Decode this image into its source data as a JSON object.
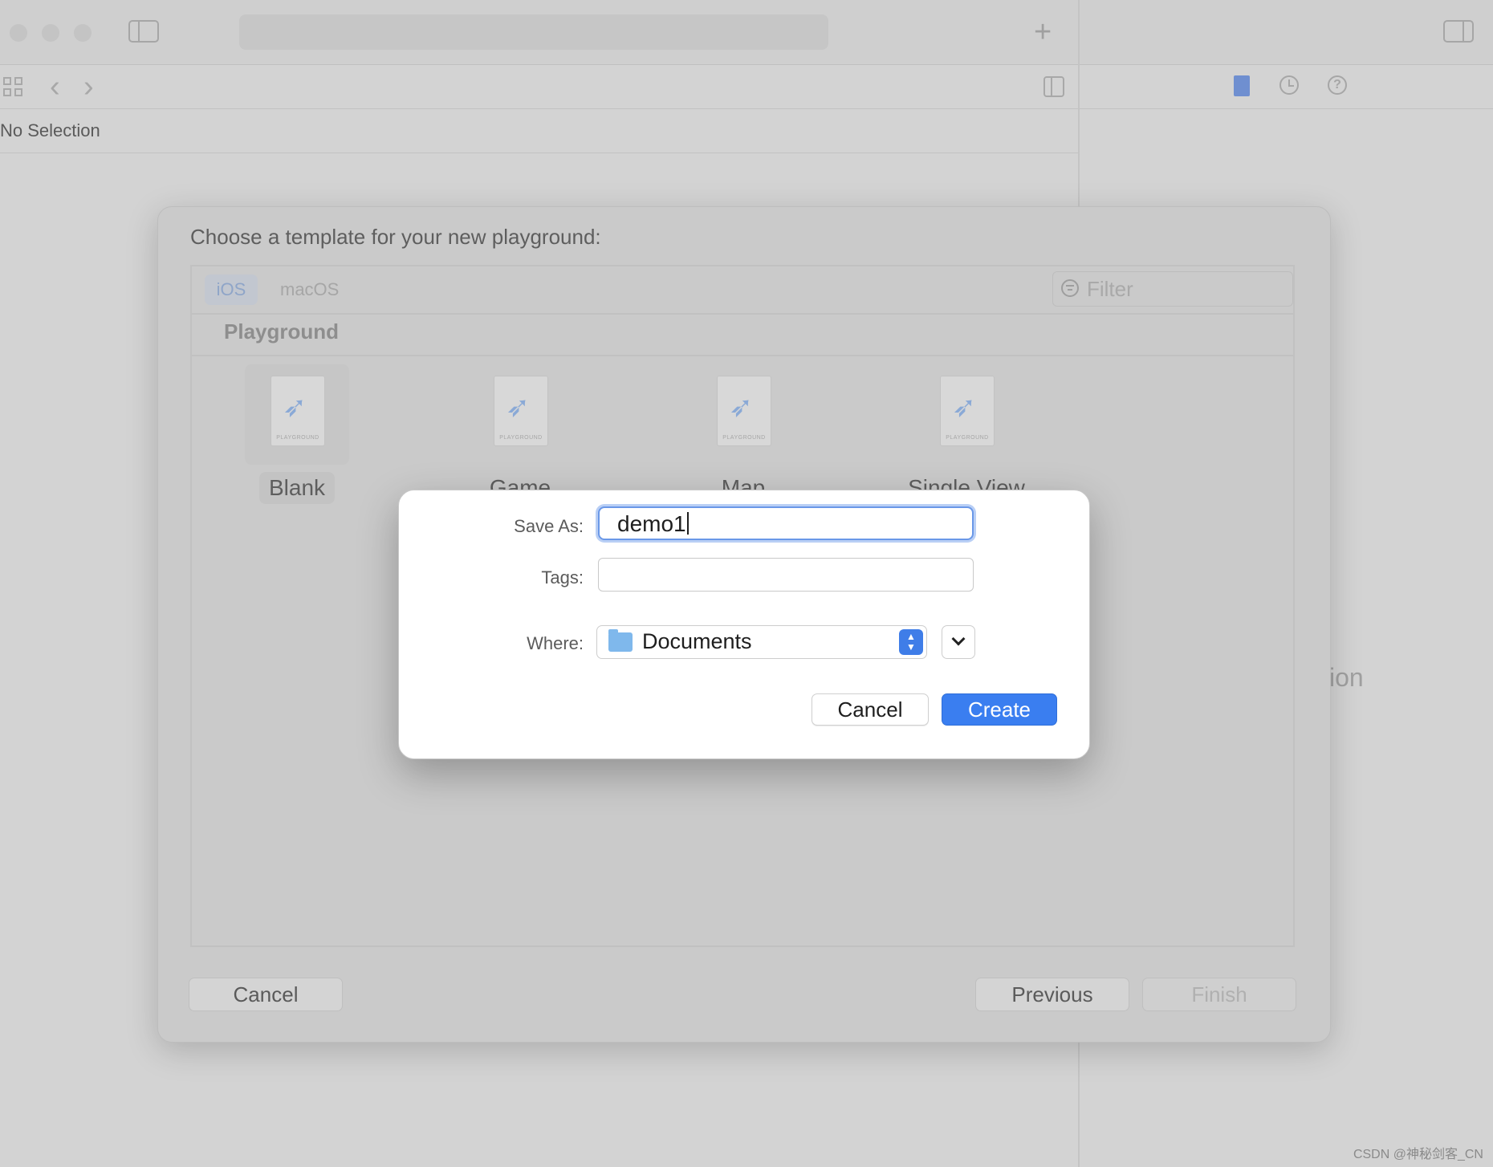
{
  "window": {
    "no_selection": "No Selection",
    "inspector_partial_text": "ion"
  },
  "template_sheet": {
    "title": "Choose a template for your new playground:",
    "tabs": [
      "iOS",
      "macOS"
    ],
    "selected_tab": "iOS",
    "filter_placeholder": "Filter",
    "section": "Playground",
    "templates": [
      {
        "name": "Blank",
        "icon_caption": "PLAYGROUND",
        "selected": true
      },
      {
        "name": "Game",
        "icon_caption": "PLAYGROUND",
        "selected": false
      },
      {
        "name": "Map",
        "icon_caption": "PLAYGROUND",
        "selected": false
      },
      {
        "name": "Single View",
        "icon_caption": "PLAYGROUND",
        "selected": false
      }
    ],
    "buttons": {
      "cancel": "Cancel",
      "previous": "Previous",
      "finish": "Finish"
    }
  },
  "save_dialog": {
    "save_as_label": "Save As:",
    "save_as_value": "demo1",
    "tags_label": "Tags:",
    "tags_value": "",
    "where_label": "Where:",
    "where_value": "Documents",
    "cancel": "Cancel",
    "create": "Create"
  },
  "colors": {
    "accent": "#3a7ef0",
    "focus_ring": "#6a98e8",
    "folder": "#7fb8ec"
  },
  "watermark": "CSDN @神秘剑客_CN"
}
